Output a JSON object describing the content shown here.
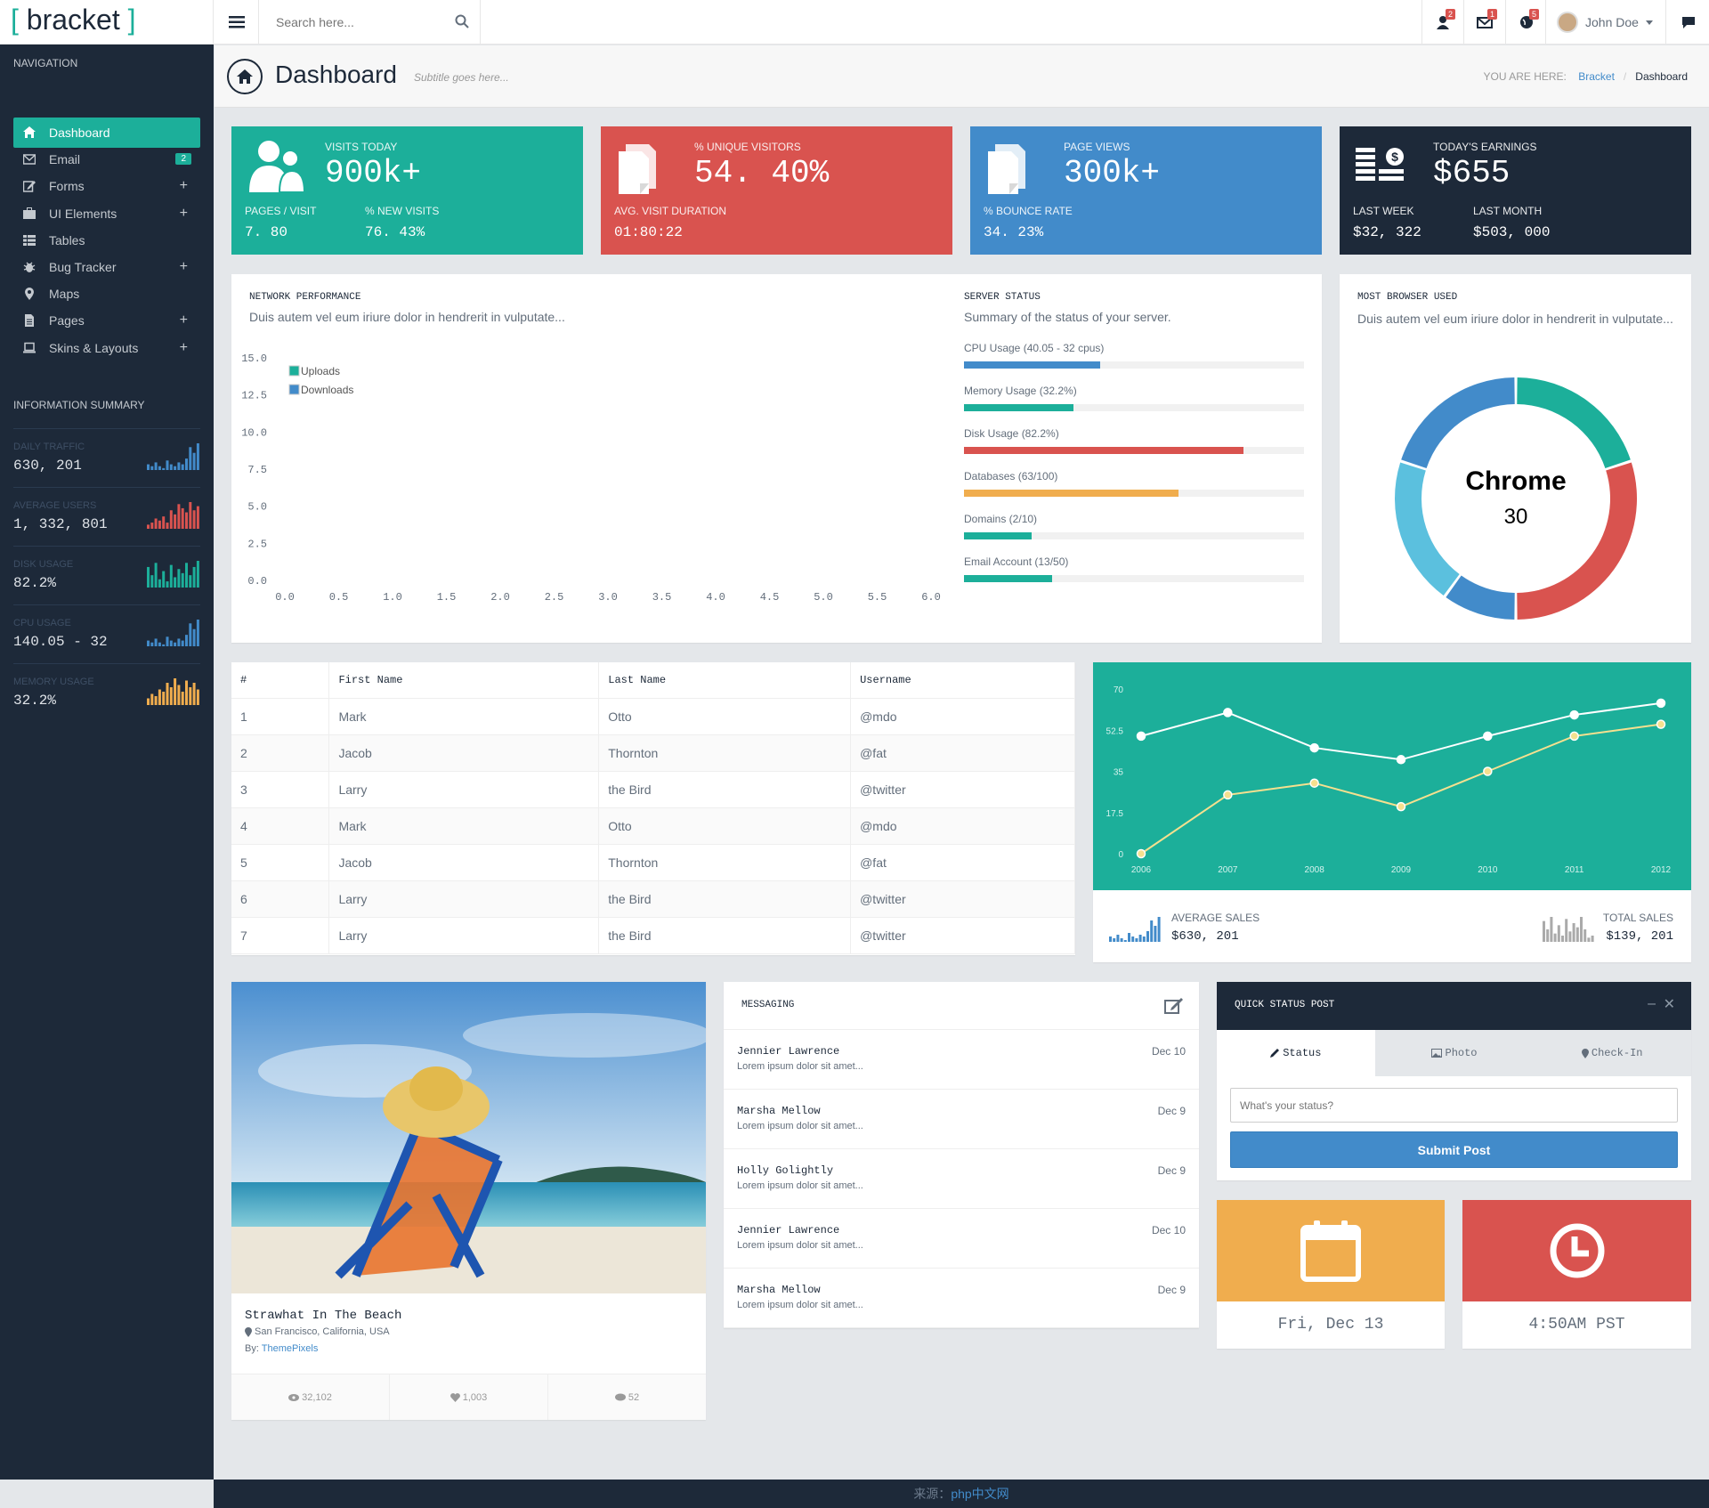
{
  "topbar": {
    "logo_open": "[",
    "logo_text": "bracket",
    "logo_close": "]",
    "search_placeholder": "Search here...",
    "notifications": [
      {
        "icon": "users-icon",
        "count": "2"
      },
      {
        "icon": "envelope-icon",
        "count": "1"
      },
      {
        "icon": "globe-icon",
        "count": "5"
      }
    ],
    "user_name": "John Doe"
  },
  "sidebar": {
    "nav_heading": "Navigation",
    "items": [
      {
        "label": "Dashboard",
        "icon": "home-icon",
        "active": true
      },
      {
        "label": "Email",
        "icon": "envelope-icon",
        "badge": "2"
      },
      {
        "label": "Forms",
        "icon": "edit-icon",
        "expand": "+"
      },
      {
        "label": "UI Elements",
        "icon": "suitcase-icon",
        "expand": "+"
      },
      {
        "label": "Tables",
        "icon": "table-icon"
      },
      {
        "label": "Bug Tracker",
        "icon": "bug-icon",
        "expand": "+"
      },
      {
        "label": "Maps",
        "icon": "map-marker-icon"
      },
      {
        "label": "Pages",
        "icon": "file-icon",
        "expand": "+"
      },
      {
        "label": "Skins & Layouts",
        "icon": "laptop-icon",
        "expand": "+"
      }
    ],
    "info_heading": "Information Summary",
    "info": [
      {
        "label": "Daily Traffic",
        "value": "630, 201",
        "color": "#428bca",
        "bars": [
          3,
          2,
          4,
          2,
          1,
          5,
          3,
          2,
          4,
          3,
          6,
          12,
          9,
          14
        ]
      },
      {
        "label": "Average Users",
        "value": "1, 332, 801",
        "color": "#d9534f",
        "bars": [
          2,
          3,
          5,
          4,
          6,
          3,
          9,
          7,
          12,
          10,
          8,
          13,
          9,
          11
        ]
      },
      {
        "label": "Disk Usage",
        "value": "82.2%",
        "color": "#1caf9a",
        "bars": [
          10,
          6,
          12,
          4,
          8,
          3,
          11,
          5,
          9,
          7,
          12,
          6,
          10,
          13
        ]
      },
      {
        "label": "CPU Usage",
        "value": "140.05 - 32",
        "color": "#428bca",
        "bars": [
          3,
          2,
          4,
          2,
          1,
          5,
          3,
          2,
          4,
          3,
          6,
          12,
          9,
          14
        ]
      },
      {
        "label": "Memory Usage",
        "value": "32.2%",
        "color": "#f0ad4e",
        "bars": [
          3,
          5,
          4,
          7,
          6,
          10,
          8,
          12,
          9,
          6,
          11,
          8,
          10,
          7
        ]
      }
    ]
  },
  "pageheader": {
    "title": "Dashboard",
    "subtitle": "Subtitle goes here...",
    "you_are_here": "YOU ARE HERE:",
    "crumb_link": "Bracket",
    "crumb_sep": "/",
    "crumb_current": "Dashboard"
  },
  "tiles": [
    {
      "color": "#1caf9a",
      "icon": "users-icon",
      "label": "Visits Today",
      "value": "900k+",
      "sub": [
        {
          "label": "Pages / Visit",
          "value": "7. 80"
        },
        {
          "label": "% New Visits",
          "value": "76. 43%"
        }
      ]
    },
    {
      "color": "#d9534f",
      "icon": "documents-icon",
      "label": "% Unique Visitors",
      "value": "54. 40%",
      "sub": [
        {
          "label": "Avg. Visit Duration",
          "value": "01:80:22"
        }
      ]
    },
    {
      "color": "#428bca",
      "icon": "documents-icon",
      "label": "Page Views",
      "value": "300k+",
      "sub": [
        {
          "label": "% Bounce Rate",
          "value": "34. 23%"
        }
      ]
    },
    {
      "color": "#1d2939",
      "icon": "money-icon",
      "label": "Today's Earnings",
      "value": "$655",
      "sub": [
        {
          "label": "Last Week",
          "value": "$32, 322"
        },
        {
          "label": "Last Month",
          "value": "$503, 000"
        }
      ]
    }
  ],
  "network": {
    "title": "Network Performance",
    "subtitle": "Duis autem vel eum iriure dolor in hendrerit in vulputate...",
    "legend": [
      "Uploads",
      "Downloads"
    ],
    "legend_colors": [
      "#1caf9a",
      "#428bca"
    ]
  },
  "chart_data": [
    {
      "type": "line",
      "title": "Network Performance",
      "x_ticks": [
        "0.0",
        "0.5",
        "1.0",
        "1.5",
        "2.0",
        "2.5",
        "3.0",
        "3.5",
        "4.0",
        "4.5",
        "5.0",
        "5.5",
        "6.0"
      ],
      "y_ticks": [
        "0.0",
        "2.5",
        "5.0",
        "7.5",
        "10.0",
        "12.5",
        "15.0"
      ],
      "xlim": [
        0,
        6
      ],
      "ylim": [
        0,
        15
      ],
      "series": [
        {
          "name": "Uploads",
          "color": "#1caf9a",
          "values": []
        },
        {
          "name": "Downloads",
          "color": "#428bca",
          "values": []
        }
      ],
      "legend": "top-left",
      "grid": false
    },
    {
      "type": "pie",
      "title": "Most Browser Used",
      "center_label": "Chrome",
      "center_value": "30",
      "slices": [
        {
          "value": 20,
          "color": "#1caf9a"
        },
        {
          "value": 30,
          "color": "#d9534f"
        },
        {
          "value": 10,
          "color": "#428bca"
        },
        {
          "value": 20,
          "color": "#5bc0de"
        },
        {
          "value": 20,
          "color": "#428bca"
        }
      ]
    },
    {
      "type": "line",
      "categories": [
        "2006",
        "2007",
        "2008",
        "2009",
        "2010",
        "2011",
        "2012"
      ],
      "y_ticks": [
        "0",
        "17.5",
        "35",
        "52.5",
        "70"
      ],
      "ylim": [
        0,
        70
      ],
      "background": "#1caf9a",
      "series": [
        {
          "color": "#ffffff",
          "values": [
            50,
            60,
            45,
            40,
            50,
            59,
            64
          ]
        },
        {
          "color": "#f5e08f",
          "values": [
            0,
            25,
            30,
            20,
            35,
            50,
            55
          ]
        }
      ]
    }
  ],
  "server": {
    "title": "Server Status",
    "subtitle": "Summary of the status of your server.",
    "rows": [
      {
        "label": "CPU Usage (40.05 - 32 cpus)",
        "pct": 40,
        "color": "#428bca"
      },
      {
        "label": "Memory Usage (32.2%)",
        "pct": 32.2,
        "color": "#1caf9a"
      },
      {
        "label": "Disk Usage (82.2%)",
        "pct": 82.2,
        "color": "#d9534f"
      },
      {
        "label": "Databases (63/100)",
        "pct": 63,
        "color": "#f0ad4e"
      },
      {
        "label": "Domains (2/10)",
        "pct": 20,
        "color": "#1caf9a"
      },
      {
        "label": "Email Account (13/50)",
        "pct": 26,
        "color": "#1caf9a"
      }
    ]
  },
  "browser": {
    "title": "Most Browser Used",
    "subtitle": "Duis autem vel eum iriure dolor in hendrerit in vulputate...",
    "center_label": "Chrome",
    "center_value": "30"
  },
  "table": {
    "headers": [
      "#",
      "First Name",
      "Last Name",
      "Username"
    ],
    "rows": [
      [
        "1",
        "Mark",
        "Otto",
        "@mdo"
      ],
      [
        "2",
        "Jacob",
        "Thornton",
        "@fat"
      ],
      [
        "3",
        "Larry",
        "the Bird",
        "@twitter"
      ],
      [
        "4",
        "Mark",
        "Otto",
        "@mdo"
      ],
      [
        "5",
        "Jacob",
        "Thornton",
        "@fat"
      ],
      [
        "6",
        "Larry",
        "the Bird",
        "@twitter"
      ],
      [
        "7",
        "Larry",
        "the Bird",
        "@twitter"
      ]
    ]
  },
  "sales": {
    "avg_label": "Average Sales",
    "avg_value": "$630, 201",
    "total_label": "Total Sales",
    "total_value": "$139, 201"
  },
  "photo": {
    "title": "Strawhat In The Beach",
    "location": "San Francisco, California, USA",
    "by_label": "By:",
    "author": "ThemePixels",
    "views": "32,102",
    "likes": "1,003",
    "comments": "52"
  },
  "messaging": {
    "title": "Messaging",
    "items": [
      {
        "name": "Jennier Lawrence",
        "text": "Lorem ipsum dolor sit amet...",
        "date": "Dec 10"
      },
      {
        "name": "Marsha Mellow",
        "text": "Lorem ipsum dolor sit amet...",
        "date": "Dec 9"
      },
      {
        "name": "Holly Golightly",
        "text": "Lorem ipsum dolor sit amet...",
        "date": "Dec 9"
      },
      {
        "name": "Jennier Lawrence",
        "text": "Lorem ipsum dolor sit amet...",
        "date": "Dec 10"
      },
      {
        "name": "Marsha Mellow",
        "text": "Lorem ipsum dolor sit amet...",
        "date": "Dec 9"
      }
    ]
  },
  "quick_status": {
    "title": "Quick Status Post",
    "tabs": [
      "Status",
      "Photo",
      "Check-In"
    ],
    "placeholder": "What's your status?",
    "submit": "Submit Post"
  },
  "date_tile": {
    "color": "#f0ad4e",
    "text": "Fri, Dec 13"
  },
  "time_tile": {
    "color": "#d9534f",
    "text": "4:50AM PST"
  },
  "footer": {
    "prefix": "来源：",
    "source": "php中文网"
  }
}
